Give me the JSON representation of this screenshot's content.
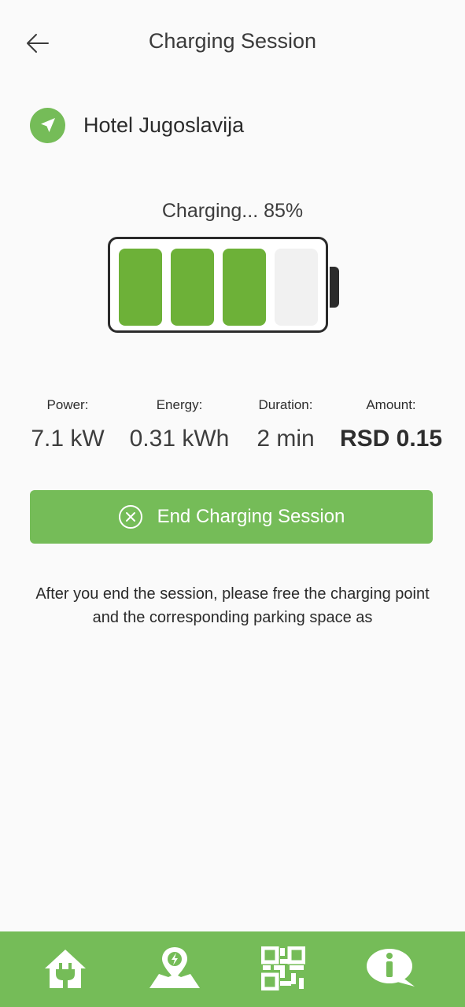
{
  "header": {
    "title": "Charging Session"
  },
  "location": {
    "name": "Hotel Jugoslavija"
  },
  "charging": {
    "status_text": "Charging... 85%",
    "level_percent": 85,
    "cells_filled": 3,
    "cells_total": 4
  },
  "stats": [
    {
      "label": "Power:",
      "value": "7.1 kW"
    },
    {
      "label": "Energy:",
      "value": "0.31 kWh"
    },
    {
      "label": "Duration:",
      "value": "2 min"
    },
    {
      "label": "Amount:",
      "value": "RSD 0.15"
    }
  ],
  "end_button": {
    "label": "End Charging Session"
  },
  "note": "After you end the session, please free the charging point and the corresponding parking space as",
  "bottom_nav": [
    {
      "name": "home-plug-icon"
    },
    {
      "name": "map-charging-icon"
    },
    {
      "name": "qr-code-icon"
    },
    {
      "name": "info-chat-icon"
    }
  ],
  "colors": {
    "accent": "#75bc58",
    "battery_cell_filled": "#6db138",
    "battery_cell_empty": "#f1f1f1",
    "background": "#fafafa"
  }
}
